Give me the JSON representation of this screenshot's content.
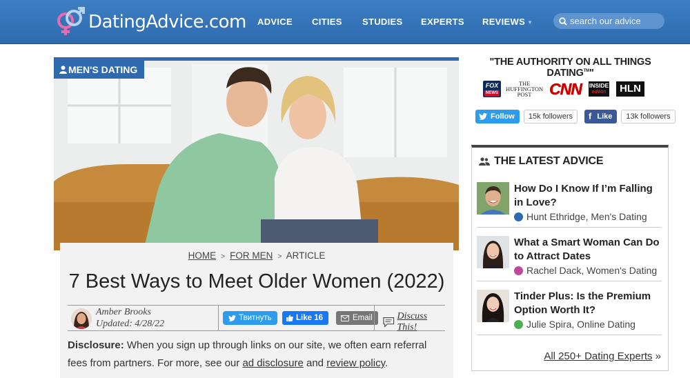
{
  "header": {
    "logo_text": "DatingAdvice.com",
    "nav": [
      "ADVICE",
      "CITIES",
      "STUDIES",
      "EXPERTS",
      "REVIEWS"
    ],
    "search_placeholder": "search our advice"
  },
  "hero": {
    "category": "MEN'S DATING"
  },
  "article": {
    "breadcrumb": [
      "HOME",
      "FOR MEN",
      "ARTICLE"
    ],
    "breadcrumb_sep": ">",
    "title": "7 Best Ways to Meet Older Women (2022)",
    "author": "Amber Brooks",
    "updated": "Updated: 4/28/22",
    "tweet_label": "Твитнуть",
    "like_label": "Like 16",
    "email_label": "Email",
    "discuss_label": "Discuss This!",
    "disclosure_label": "Disclosure:",
    "disclosure_text": " When you sign up through links on our site, we often earn referral fees from partners. For more, see our ",
    "ad_disclosure_link": "ad disclosure",
    "and_text": " and ",
    "review_policy_link": "review policy",
    "period": "."
  },
  "sidebar": {
    "authority": "\"THE AUTHORITY ON ALL THINGS DATING",
    "authority_tm": "TM",
    "authority_end": "\"",
    "press": {
      "fox_top": "FOX",
      "fox_bottom": "NEWS",
      "huffington_1": "THE",
      "huffington_2": "HUFFINGTON",
      "huffington_3": "POST",
      "cnn": "CNN",
      "inside_1": "INSIDE",
      "inside_2": "edition",
      "hln": "HLN"
    },
    "twitter_follow": "Follow",
    "twitter_count": "15k followers",
    "facebook_like": "Like",
    "facebook_count": "13k followers",
    "latest_title": "THE LATEST ADVICE",
    "items": [
      {
        "title": "How Do I Know If I’m Falling in Love?",
        "meta": "Hunt Ethridge, Men's Dating",
        "dot_color": "#2f6aae"
      },
      {
        "title": "What a Smart Woman Can Do to Attract Dates",
        "meta": "Rachel Dack, Women's Dating",
        "dot_color": "#c0479a"
      },
      {
        "title": "Tinder Plus: Is the Premium Option Worth It?",
        "meta": "Julie Spira, Online Dating",
        "dot_color": "#4caf50"
      }
    ],
    "all_experts": "All 250+ Dating Experts",
    "all_experts_arrow": " »"
  }
}
